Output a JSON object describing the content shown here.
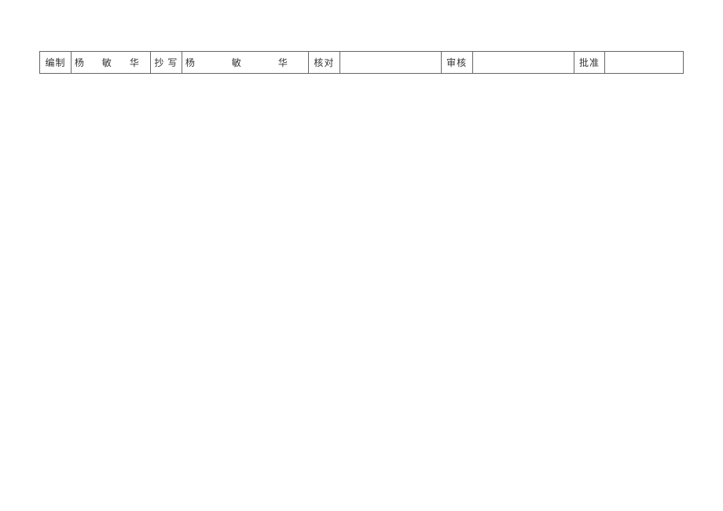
{
  "signature_row": {
    "compile_label": "编制",
    "compile_name": "杨 敏 华",
    "copy_label": "抄 写",
    "copy_name": "杨 敏 华",
    "check_label": "核对",
    "check_name": "",
    "review_label": "审核",
    "review_name": "",
    "approve_label": "批准",
    "approve_name": ""
  }
}
